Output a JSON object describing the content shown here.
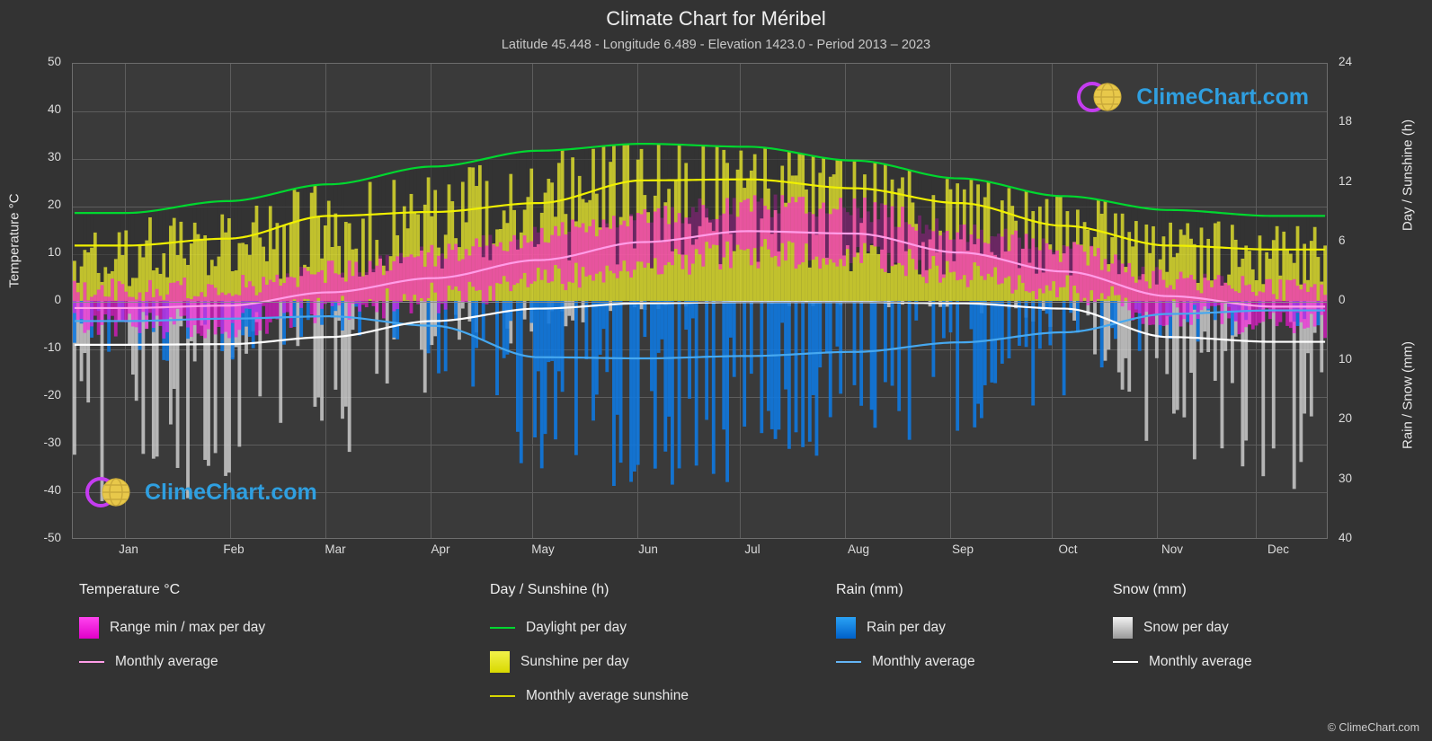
{
  "header": {
    "title": "Climate Chart for Méribel",
    "subtitle": "Latitude 45.448 - Longitude 6.489 - Elevation 1423.0 - Period 2013 – 2023"
  },
  "axes": {
    "left_label": "Temperature °C",
    "right_label_top": "Day / Sunshine (h)",
    "right_label_bottom": "Rain / Snow (mm)",
    "left_ticks": [
      "50",
      "40",
      "30",
      "20",
      "10",
      "0",
      "-10",
      "-20",
      "-30",
      "-40",
      "-50"
    ],
    "right_ticks_top": [
      "24",
      "18",
      "12",
      "6",
      "0"
    ],
    "right_ticks_bottom": [
      "10",
      "20",
      "30",
      "40"
    ],
    "x_ticks": [
      "Jan",
      "Feb",
      "Mar",
      "Apr",
      "May",
      "Jun",
      "Jul",
      "Aug",
      "Sep",
      "Oct",
      "Nov",
      "Dec"
    ]
  },
  "legend": {
    "temperature": {
      "head": "Temperature °C",
      "items": [
        {
          "label": "Range min / max per day",
          "type": "box",
          "color": "#ff00e0"
        },
        {
          "label": "Monthly average",
          "type": "line",
          "color": "#ff9de8"
        }
      ]
    },
    "day_sunshine": {
      "head": "Day / Sunshine (h)",
      "items": [
        {
          "label": "Daylight per day",
          "type": "line",
          "color": "#00d72f"
        },
        {
          "label": "Sunshine per day",
          "type": "box",
          "color": "#e8e82a"
        },
        {
          "label": "Monthly average sunshine",
          "type": "line",
          "color": "#d6d600"
        }
      ]
    },
    "rain": {
      "head": "Rain (mm)",
      "items": [
        {
          "label": "Rain per day",
          "type": "box",
          "color": "#0d8bf0"
        },
        {
          "label": "Monthly average",
          "type": "line",
          "color": "#64b5f6"
        }
      ]
    },
    "snow": {
      "head": "Snow (mm)",
      "items": [
        {
          "label": "Snow per day",
          "type": "box",
          "color": "#d8d8d8"
        },
        {
          "label": "Monthly average",
          "type": "line",
          "color": "#ffffff"
        }
      ]
    }
  },
  "watermark": {
    "text_prefix": "Clime",
    "text_suffix": "Chart.com"
  },
  "copyright": "© ClimeChart.com",
  "chart_data": {
    "type": "area",
    "title": "Climate Chart for Méribel",
    "subtitle": "Latitude 45.448 - Longitude 6.489 - Elevation 1423.0 - Period 2013 – 2023",
    "xlabel": "",
    "ylabel": "Temperature °C",
    "ylim": [
      -50,
      50
    ],
    "y2lim_top": [
      0,
      24
    ],
    "y2lim_bottom": [
      0,
      40
    ],
    "grid": true,
    "legend_position": "below",
    "categories": [
      "Jan",
      "Feb",
      "Mar",
      "Apr",
      "May",
      "Jun",
      "Jul",
      "Aug",
      "Sep",
      "Oct",
      "Nov",
      "Dec"
    ],
    "series": [
      {
        "name": "Daylight per day (h)",
        "unit": "h",
        "axis": "right-top",
        "color": "#00d72f",
        "values": [
          8.9,
          10.1,
          11.8,
          13.6,
          15.2,
          15.9,
          15.6,
          14.2,
          12.4,
          10.6,
          9.2,
          8.6
        ]
      },
      {
        "name": "Monthly average sunshine (h)",
        "unit": "h",
        "axis": "right-top",
        "color": "#e8e82a",
        "values": [
          5.6,
          6.3,
          8.6,
          9.0,
          9.9,
          12.2,
          12.3,
          11.4,
          9.9,
          7.6,
          5.6,
          5.2
        ]
      },
      {
        "name": "Monthly average temperature (°C)",
        "unit": "°C",
        "axis": "left",
        "color": "#ff9de8",
        "values": [
          -1.5,
          -1.0,
          1.8,
          4.8,
          8.6,
          12.4,
          14.7,
          14.2,
          10.2,
          6.2,
          1.0,
          -1.2
        ]
      },
      {
        "name": "Monthly average rain (mm)",
        "unit": "mm",
        "axis": "right-bottom",
        "color": "#64b5f6",
        "values": [
          3.4,
          3.0,
          2.6,
          4.2,
          9.5,
          9.7,
          9.3,
          8.6,
          7.0,
          5.3,
          2.2,
          1.6
        ]
      },
      {
        "name": "Monthly average snow (mm)",
        "unit": "mm",
        "axis": "right-bottom",
        "color": "#ffffff",
        "values": [
          7.4,
          7.3,
          6.1,
          3.4,
          1.3,
          0.4,
          0.2,
          0.2,
          0.4,
          1.3,
          6.1,
          6.9
        ]
      },
      {
        "name": "Daily temperature range min (°C)",
        "unit": "°C",
        "axis": "left",
        "color": "#ff00e0",
        "values": [
          -5.0,
          -4.6,
          -2.2,
          0.6,
          4.2,
          7.8,
          10.1,
          9.8,
          6.0,
          2.4,
          -2.4,
          -4.6
        ]
      },
      {
        "name": "Daily temperature range max (°C)",
        "unit": "°C",
        "axis": "left",
        "color": "#ff00e0",
        "values": [
          2.2,
          3.0,
          6.0,
          9.4,
          13.6,
          17.8,
          20.2,
          19.4,
          15.0,
          10.4,
          4.6,
          2.4
        ]
      }
    ]
  }
}
